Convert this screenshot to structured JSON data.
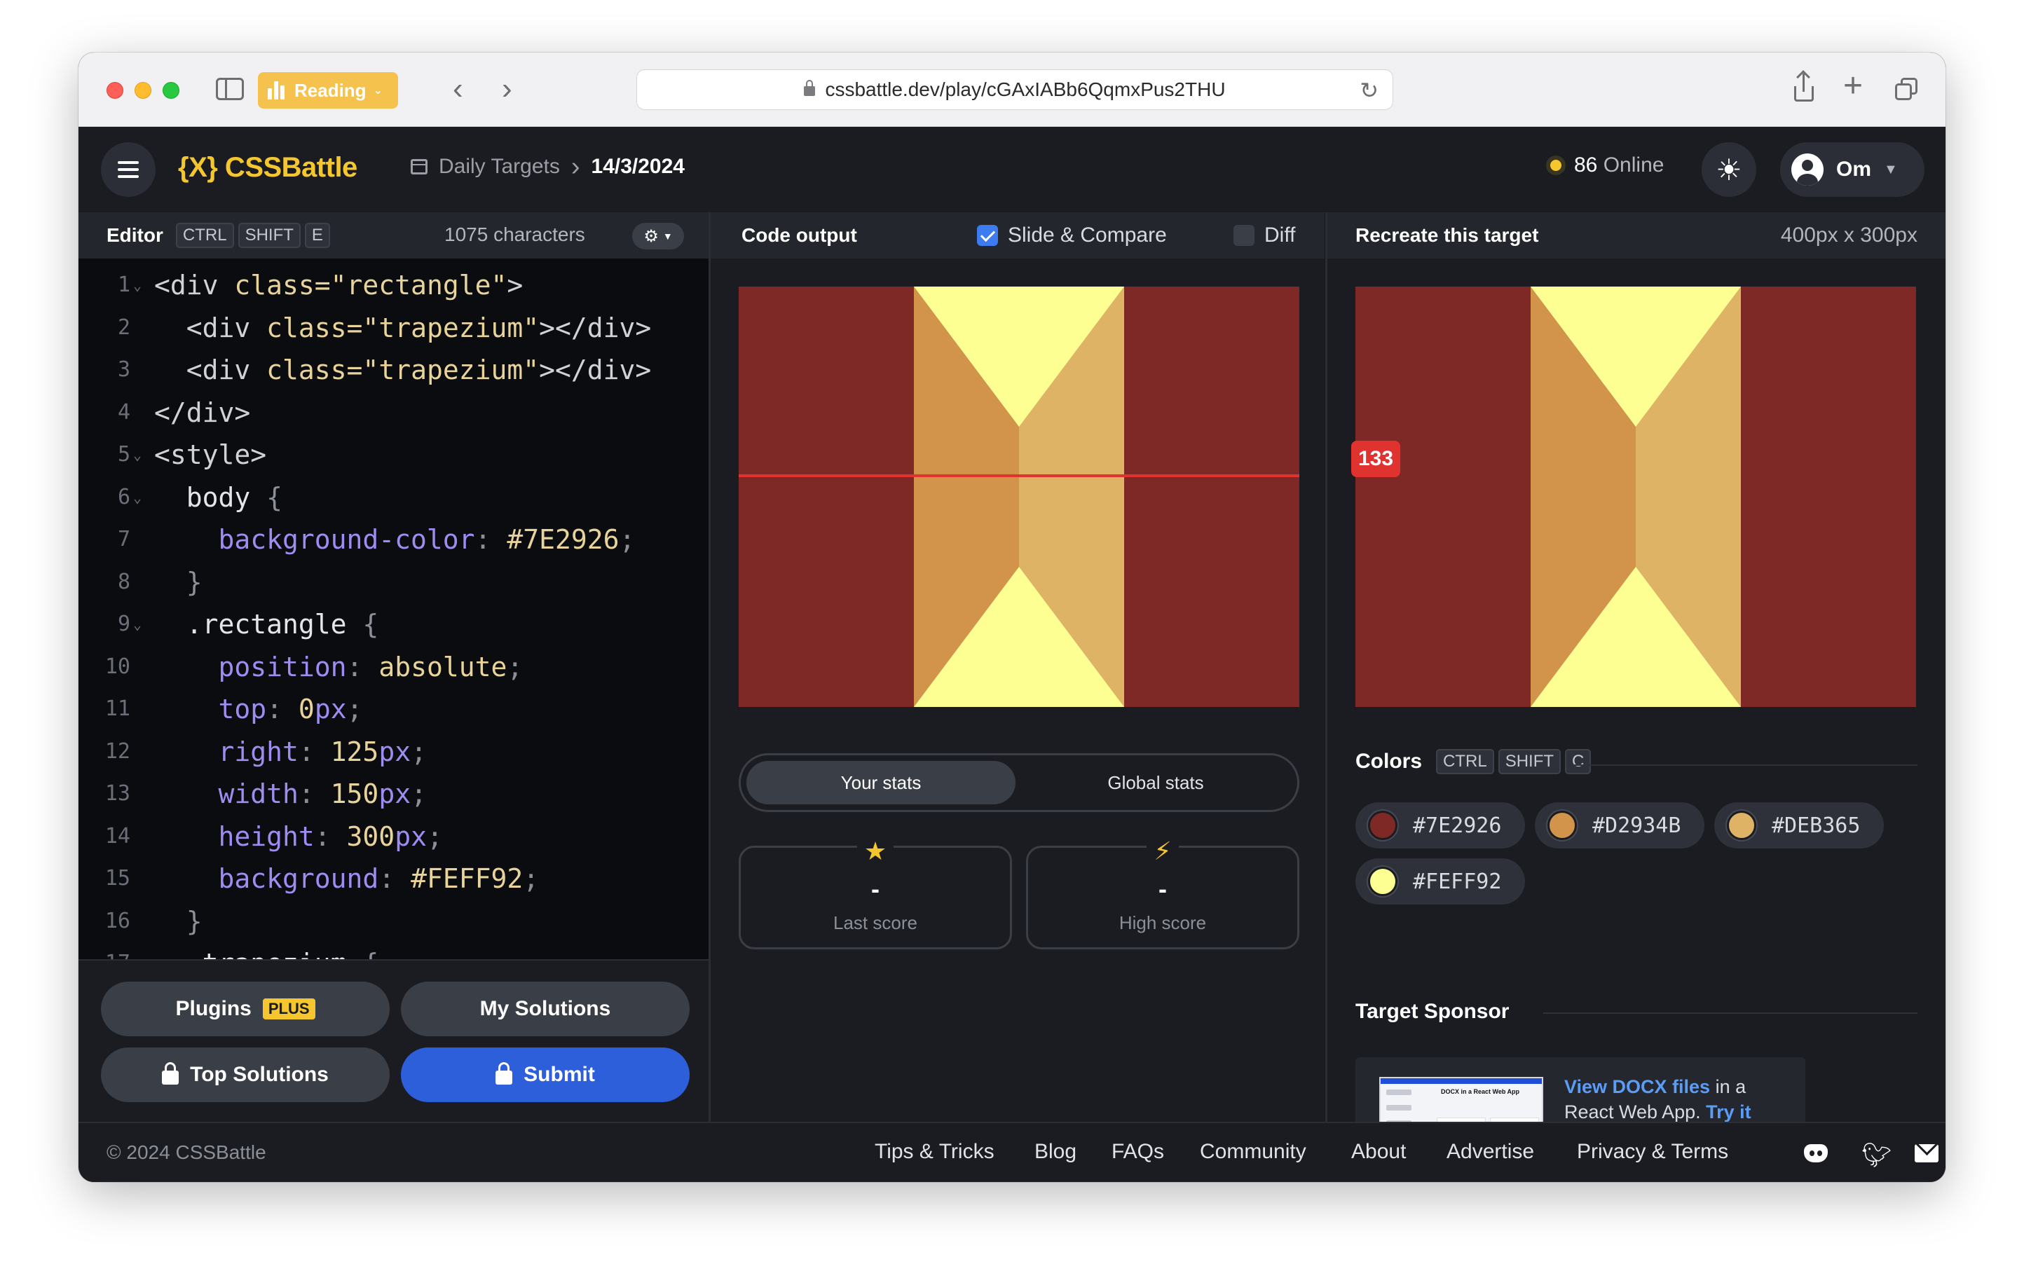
{
  "browser": {
    "reading_label": "Reading",
    "url": "cssbattle.dev/play/cGAxIABb6QqmxPus2THU"
  },
  "header": {
    "logo": "{X} CSSBattle",
    "breadcrumb_section": "Daily Targets",
    "breadcrumb_current": "14/3/2024",
    "online_count": "86",
    "online_label": "Online",
    "user_name": "Om"
  },
  "editor": {
    "title": "Editor",
    "shortcut": [
      "CTRL",
      "SHIFT",
      "E"
    ],
    "char_count": "1075 characters",
    "code": [
      {
        "n": "1",
        "fold": true,
        "tokens": [
          [
            "c-tag",
            "<div "
          ],
          [
            "c-attr",
            "class="
          ],
          [
            "c-str",
            "\"rectangle\""
          ],
          [
            "c-tag",
            ">"
          ]
        ]
      },
      {
        "n": "2",
        "fold": false,
        "tokens": [
          [
            "c-tag",
            "  <div "
          ],
          [
            "c-attr",
            "class="
          ],
          [
            "c-str",
            "\"trapezium\""
          ],
          [
            "c-tag",
            "></div>"
          ]
        ]
      },
      {
        "n": "3",
        "fold": false,
        "tokens": [
          [
            "c-tag",
            "  <div "
          ],
          [
            "c-attr",
            "class="
          ],
          [
            "c-str",
            "\"trapezium\""
          ],
          [
            "c-tag",
            "></div>"
          ]
        ]
      },
      {
        "n": "4",
        "fold": false,
        "tokens": [
          [
            "c-tag",
            "</div>"
          ]
        ]
      },
      {
        "n": "5",
        "fold": true,
        "tokens": [
          [
            "c-tag",
            "<style>"
          ]
        ]
      },
      {
        "n": "6",
        "fold": true,
        "tokens": [
          [
            "c-sel",
            "  body "
          ],
          [
            "c-punc",
            "{"
          ]
        ]
      },
      {
        "n": "7",
        "fold": false,
        "tokens": [
          [
            "c-prop",
            "    background-color"
          ],
          [
            "c-punc",
            ": "
          ],
          [
            "c-val",
            "#7E2926"
          ],
          [
            "c-punc",
            ";"
          ]
        ]
      },
      {
        "n": "8",
        "fold": false,
        "tokens": [
          [
            "c-punc",
            "  }"
          ]
        ]
      },
      {
        "n": "9",
        "fold": true,
        "tokens": [
          [
            "c-sel",
            "  .rectangle "
          ],
          [
            "c-punc",
            "{"
          ]
        ]
      },
      {
        "n": "10",
        "fold": false,
        "tokens": [
          [
            "c-prop",
            "    position"
          ],
          [
            "c-punc",
            ": "
          ],
          [
            "c-val",
            "absolute"
          ],
          [
            "c-punc",
            ";"
          ]
        ]
      },
      {
        "n": "11",
        "fold": false,
        "tokens": [
          [
            "c-prop",
            "    top"
          ],
          [
            "c-punc",
            ": "
          ],
          [
            "c-val",
            "0"
          ],
          [
            "c-unit",
            "px"
          ],
          [
            "c-punc",
            ";"
          ]
        ]
      },
      {
        "n": "12",
        "fold": false,
        "tokens": [
          [
            "c-prop",
            "    right"
          ],
          [
            "c-punc",
            ": "
          ],
          [
            "c-val",
            "125"
          ],
          [
            "c-unit",
            "px"
          ],
          [
            "c-punc",
            ";"
          ]
        ]
      },
      {
        "n": "13",
        "fold": false,
        "tokens": [
          [
            "c-prop",
            "    width"
          ],
          [
            "c-punc",
            ": "
          ],
          [
            "c-val",
            "150"
          ],
          [
            "c-unit",
            "px"
          ],
          [
            "c-punc",
            ";"
          ]
        ]
      },
      {
        "n": "14",
        "fold": false,
        "tokens": [
          [
            "c-prop",
            "    height"
          ],
          [
            "c-punc",
            ": "
          ],
          [
            "c-val",
            "300"
          ],
          [
            "c-unit",
            "px"
          ],
          [
            "c-punc",
            ";"
          ]
        ]
      },
      {
        "n": "15",
        "fold": false,
        "tokens": [
          [
            "c-prop",
            "    background"
          ],
          [
            "c-punc",
            ": "
          ],
          [
            "c-val",
            "#FEFF92"
          ],
          [
            "c-punc",
            ";"
          ]
        ]
      },
      {
        "n": "16",
        "fold": false,
        "tokens": [
          [
            "c-punc",
            "  }"
          ]
        ]
      },
      {
        "n": "17",
        "fold": false,
        "tokens": [
          [
            "c-sel",
            "  .trapezium "
          ],
          [
            "c-punc",
            "{"
          ]
        ]
      }
    ],
    "buttons": {
      "plugins": "Plugins",
      "plugins_badge": "PLUS",
      "my_solutions": "My Solutions",
      "top_solutions": "Top Solutions",
      "submit": "Submit"
    }
  },
  "output": {
    "title": "Code output",
    "slide_compare_label": "Slide & Compare",
    "slide_compare_checked": true,
    "diff_label": "Diff",
    "diff_checked": false,
    "compare_value": "133",
    "stats_tabs": [
      "Your stats",
      "Global stats"
    ],
    "last_score_value": "-",
    "last_score_label": "Last score",
    "high_score_value": "-",
    "high_score_label": "High score"
  },
  "target": {
    "title": "Recreate this target",
    "size": "400px x 300px",
    "colors_title": "Colors",
    "colors_shortcut": [
      "CTRL",
      "SHIFT",
      "C"
    ],
    "colors": [
      "#7E2926",
      "#D2934B",
      "#DEB365",
      "#FEFF92"
    ],
    "sponsor_title": "Target Sponsor",
    "sponsor_thumb_title": "DOCX in a React Web App",
    "sponsor_link1": "View DOCX files",
    "sponsor_text1": " in a React Web App. ",
    "sponsor_link2": "Try it with Apryse today."
  },
  "footer": {
    "copyright": "© 2024 CSSBattle",
    "links": [
      "Tips & Tricks",
      "Blog",
      "FAQs",
      "Community",
      "About",
      "Advertise",
      "Privacy & Terms"
    ]
  },
  "colors": {
    "accent_yellow": "#F5C62E",
    "submit_blue": "#2C5FD9",
    "compare_red": "#E0322E"
  }
}
